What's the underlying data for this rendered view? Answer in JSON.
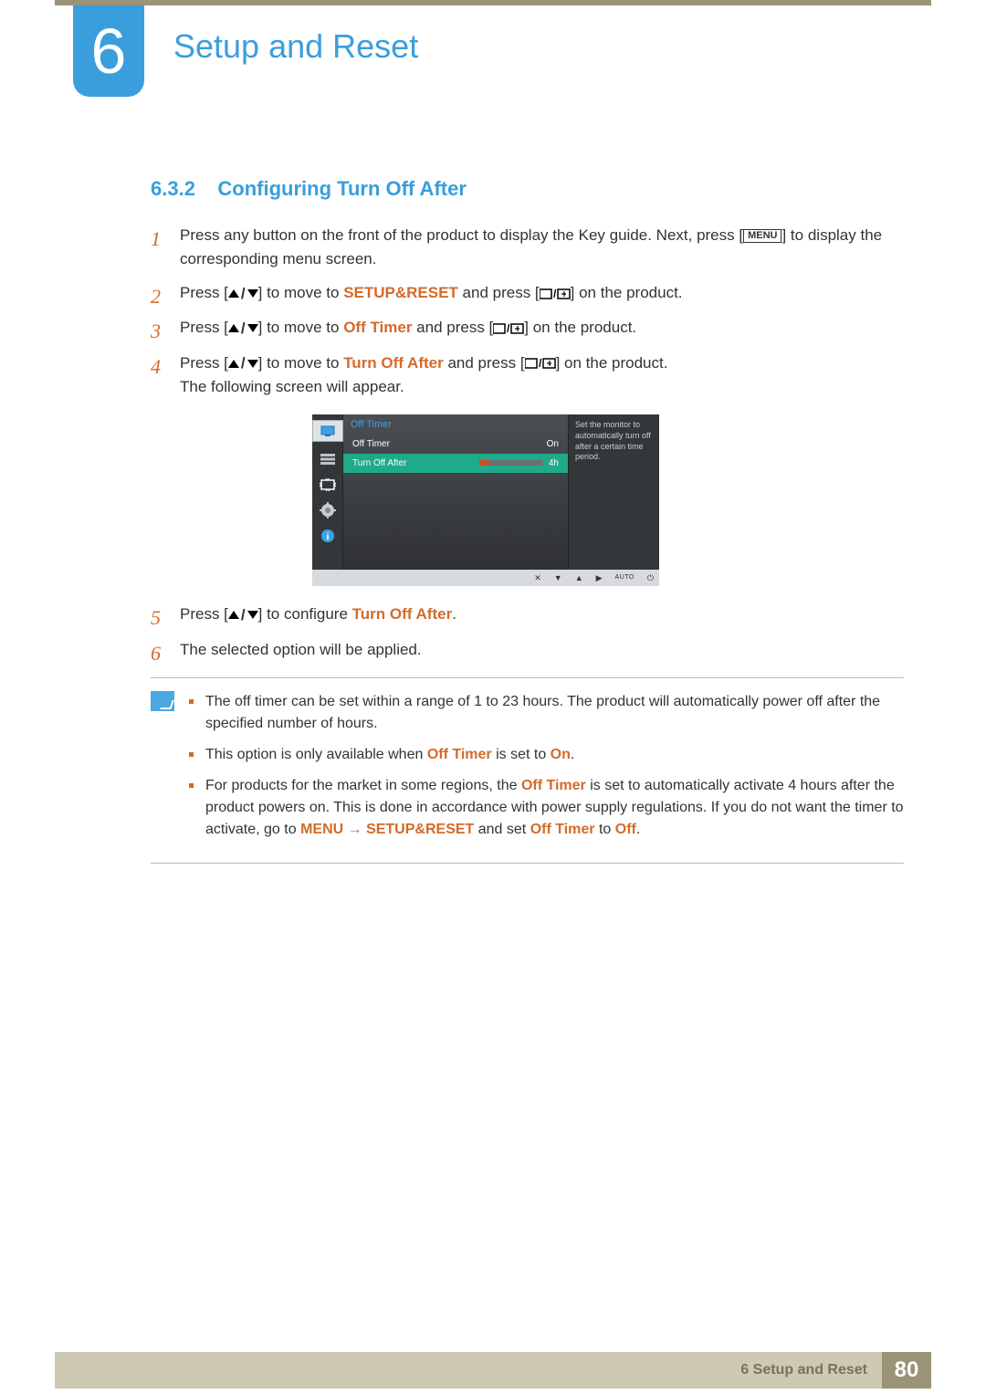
{
  "chapter": {
    "number": "6",
    "title": "Setup and Reset"
  },
  "section": {
    "number": "6.3.2",
    "title": "Configuring Turn Off After"
  },
  "buttons": {
    "menu": "MENU"
  },
  "steps": {
    "s1a": "Press any button on the front of the product to display the Key guide. Next, press [",
    "s1b": "] to display the corresponding menu screen.",
    "s2a": "Press [",
    "s2b": "] to move to ",
    "s2c": "SETUP&RESET",
    "s2d": " and press [",
    "s2e": "] on the product.",
    "s3a": "Press [",
    "s3b": "] to move to ",
    "s3c": "Off Timer",
    "s3d": " and press [",
    "s3e": "] on the product.",
    "s4a": "Press [",
    "s4b": "] to move to ",
    "s4c": "Turn Off After",
    "s4d": " and press [",
    "s4e": "] on the product.",
    "s4f": "The following screen will appear.",
    "s5a": "Press [",
    "s5b": "] to configure ",
    "s5c": "Turn Off After",
    "s5d": ".",
    "s6": "The selected option will be applied."
  },
  "osd": {
    "header": "Off Timer",
    "row1": {
      "label": "Off Timer",
      "value": "On"
    },
    "row2": {
      "label": "Turn Off After",
      "value": "4h"
    },
    "desc": "Set the monitor to automatically turn off after a certain time period.",
    "bottom": {
      "auto": "AUTO"
    }
  },
  "notes": {
    "n1": "The off timer can be set within a range of 1 to 23 hours. The product will automatically power off after the specified number of hours.",
    "n2a": "This option is only available when ",
    "n2b": "Off Timer",
    "n2c": " is set to ",
    "n2d": "On",
    "n2e": ".",
    "n3a": "For products for the market in some regions, the ",
    "n3b": "Off Timer",
    "n3c": " is set to automatically activate 4 hours after the product powers on. This is done in accordance with power supply regulations. If you do not want the timer to activate, go to ",
    "n3d": "MENU",
    "n3arrow": " → ",
    "n3e": "SETUP&RESET",
    "n3f": " and set ",
    "n3g": "Off Timer",
    "n3h": " to ",
    "n3i": "Off",
    "n3j": "."
  },
  "footer": {
    "text": "Setup and Reset",
    "chapter": "6",
    "page": "80"
  }
}
